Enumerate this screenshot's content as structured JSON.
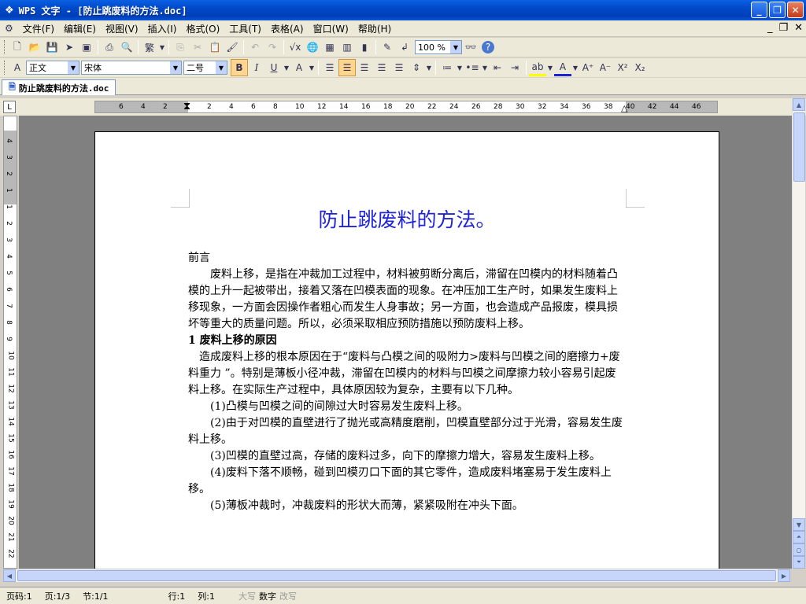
{
  "window": {
    "title": "WPS 文字 - [防止跳废料的方法.doc]"
  },
  "menu": [
    "文件(F)",
    "编辑(E)",
    "视图(V)",
    "插入(I)",
    "格式(O)",
    "工具(T)",
    "表格(A)",
    "窗口(W)",
    "帮助(H)"
  ],
  "toolbar": {
    "zoom": "100 %"
  },
  "format": {
    "style": "正文",
    "font": "宋体",
    "size": "二号"
  },
  "tab": {
    "label": "防止跳废料的方法.doc"
  },
  "ruler": {
    "h_ticks": [
      "6",
      "4",
      "2",
      "2",
      "4",
      "6",
      "8",
      "10",
      "12",
      "14",
      "16",
      "18",
      "20",
      "22",
      "24",
      "26",
      "28",
      "30",
      "32",
      "34",
      "36",
      "38",
      "40",
      "42",
      "44",
      "46"
    ],
    "v_ticks": [
      "4",
      "3",
      "2",
      "1",
      "1",
      "2",
      "3",
      "4",
      "5",
      "6",
      "7",
      "8",
      "9",
      "10",
      "11",
      "12",
      "13",
      "14",
      "15",
      "16",
      "17",
      "18",
      "19",
      "20",
      "21",
      "22"
    ]
  },
  "doc": {
    "title": "防止跳废料的方法。",
    "preface_heading": "前言",
    "preface_body": "废料上移，是指在冲裁加工过程中，材料被剪断分离后，滞留在凹模内的材料随着凸模的上升一起被带出，接着又落在凹模表面的现象。在冲压加工生产时，如果发生废料上移现象，一方面会因操作者粗心而发生人身事故；另一方面，也会造成产品报废，模具损坏等重大的质量问题。所以，必须采取相应预防措施以预防废料上移。",
    "section1_heading": "1 废料上移的原因",
    "section1_body": "造成废料上移的根本原因在于“废料与凸模之间的吸附力>废料与凹模之间的磨擦力+废料重力 ”。特别是薄板小径冲裁，滞留在凹模内的材料与凹模之间摩擦力较小容易引起废料上移。在实际生产过程中，具体原因较为复杂，主要有以下几种。",
    "items": [
      "(1)凸模与凹模之间的间隙过大时容易发生废料上移。",
      "(2)由于对凹模的直壁进行了抛光或高精度磨削，凹模直壁部分过于光滑，容易发生废料上移。",
      "(3)凹模的直壁过高，存储的废料过多，向下的摩擦力增大，容易发生废料上移。",
      "(4)废料下落不顺畅，碰到凹模刃口下面的其它零件，造成废料堵塞易于发生废料上移。",
      "(5)薄板冲裁时，冲裁废料的形状大而薄，紧紧吸附在冲头下面。"
    ]
  },
  "status": {
    "page_code": "页码:1",
    "page": "页:1/3",
    "section": "节:1/1",
    "line": "行:1",
    "col": "列:1",
    "caps": "大写",
    "num": "数字",
    "ovr": "改写"
  }
}
